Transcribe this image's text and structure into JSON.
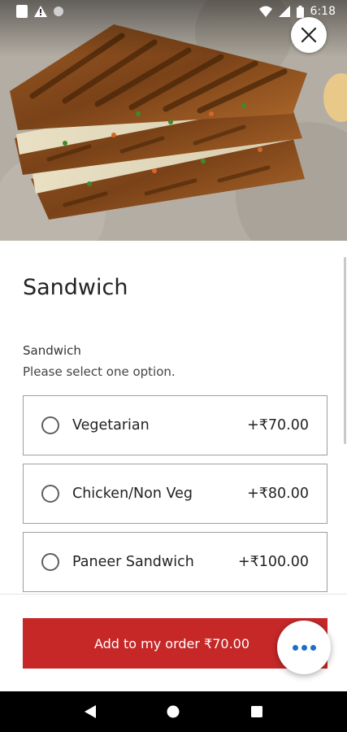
{
  "status_bar": {
    "time": "6:18",
    "icons": [
      "app-icon",
      "alert-icon",
      "sync-dot-icon",
      "wifi-icon",
      "signal-icon",
      "battery-icon"
    ]
  },
  "hero": {
    "image": "sandwich-photo",
    "close_icon": "close-icon"
  },
  "item": {
    "title": "Sandwich",
    "group_name": "Sandwich",
    "group_hint": "Please select one option."
  },
  "options": [
    {
      "label": "Vegetarian",
      "price": "+₹70.00"
    },
    {
      "label": "Chicken/Non Veg",
      "price": "+₹80.00"
    },
    {
      "label": "Paneer Sandwich",
      "price": "+₹100.00"
    }
  ],
  "footer": {
    "add_label": "Add to my order ₹70.00",
    "more_icon": "more-horizontal-icon"
  },
  "navigation": {
    "buttons": [
      "back-icon",
      "home-icon",
      "recents-icon"
    ]
  },
  "colors": {
    "accent": "#c62828",
    "more_dots": "#1e6ec8"
  }
}
